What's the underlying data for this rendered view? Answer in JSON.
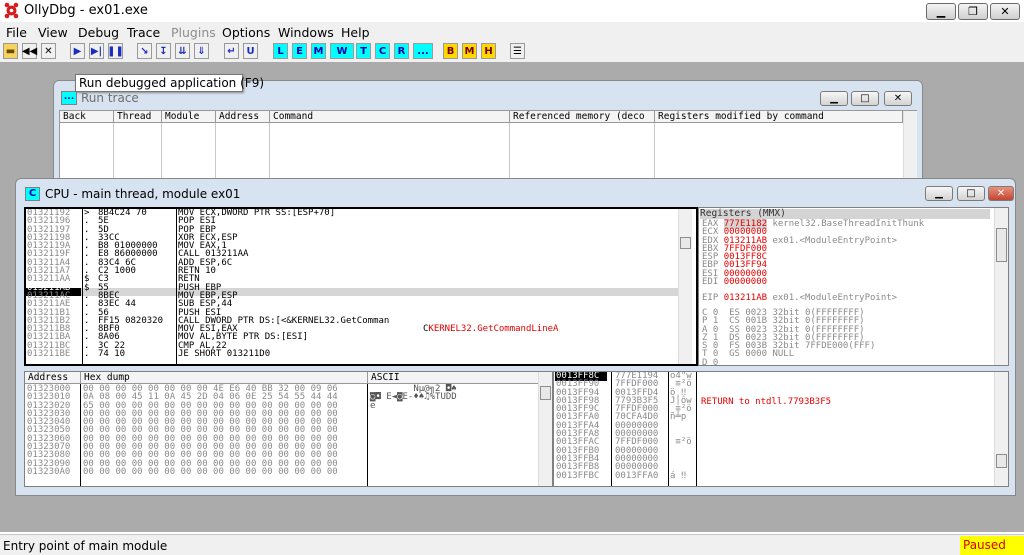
{
  "app": {
    "title": "OllyDbg - ex01.exe"
  },
  "menu": [
    "File",
    "View",
    "Debug",
    "Trace",
    "Plugins",
    "Options",
    "Windows",
    "Help"
  ],
  "toolbar_letters": [
    "L",
    "E",
    "M",
    "W",
    "T",
    "C",
    "R",
    "...",
    "B",
    "M",
    "H"
  ],
  "tooltip": "Run debugged application (F9)",
  "run_trace": {
    "title": "Run trace",
    "icon": "...",
    "columns": [
      "Back",
      "Thread",
      "Module",
      "Address",
      "Command",
      "Referenced memory (deco",
      "Registers modified by command"
    ]
  },
  "cpu": {
    "title": "CPU - main thread, module ex01",
    "icon": "C",
    "disasm": [
      {
        "addr": "01321192",
        "mark": ">",
        "hex": "8B4C24 70",
        "cmd": "MOV ECX,DWORD PTR SS:[ESP+70]"
      },
      {
        "addr": "01321196",
        "mark": ".",
        "hex": "5E",
        "cmd": "POP ESI"
      },
      {
        "addr": "01321197",
        "mark": ".",
        "hex": "5D",
        "cmd": "POP EBP"
      },
      {
        "addr": "01321198",
        "mark": ".",
        "hex": "33CC",
        "cmd": "XOR ECX,ESP"
      },
      {
        "addr": "0132119A",
        "mark": ".",
        "hex": "B8 01000000",
        "cmd": "MOV EAX,1"
      },
      {
        "addr": "0132119F",
        "mark": ".",
        "hex": "E8 86000000",
        "cmd": "CALL 013211AA"
      },
      {
        "addr": "013211A4",
        "mark": ".",
        "hex": "83C4 6C",
        "cmd": "ADD ESP,6C"
      },
      {
        "addr": "013211A7",
        "mark": ".",
        "hex": "C2 1000",
        "cmd": "RETN 10"
      },
      {
        "addr": "013211AA",
        "mark": "$",
        "hex": "C3",
        "cmd": "RETN"
      },
      {
        "addr": "013211AB",
        "mark": "$",
        "hex": "55",
        "cmd": "PUSH EBP"
      },
      {
        "addr": "013211AC",
        "mark": ".",
        "hex": "8BEC",
        "cmd": "MOV EBP,ESP"
      },
      {
        "addr": "013211AE",
        "mark": ".",
        "hex": "83EC 44",
        "cmd": "SUB ESP,44"
      },
      {
        "addr": "013211B1",
        "mark": ".",
        "hex": "56",
        "cmd": "PUSH ESI"
      },
      {
        "addr": "013211B2",
        "mark": ".",
        "hex": "FF15 0820320",
        "cmd": "CALL DWORD PTR DS:[<&KERNEL32.GetComman"
      },
      {
        "addr": "013211B8",
        "mark": ".",
        "hex": "8BF0",
        "cmd": "MOV ESI,EAX"
      },
      {
        "addr": "013211BA",
        "mark": ".",
        "hex": "8A06",
        "cmd": "MOV AL,BYTE PTR DS:[ESI]"
      },
      {
        "addr": "013211BC",
        "mark": ".",
        "hex": "3C 22",
        "cmd": "CMP AL,22"
      },
      {
        "addr": "013211BE",
        "mark": ".",
        "hex": "74 10",
        "cmd": "JE SHORT 013211D0"
      }
    ],
    "comment": "KERNEL32.GetCommandLineA",
    "registers": {
      "title": "Registers (MMX)",
      "general": [
        {
          "name": "EAX",
          "value": "777E1182",
          "info": "kernel32.BaseThreadInitThunk"
        },
        {
          "name": "ECX",
          "value": "00000000",
          "info": ""
        },
        {
          "name": "EDX",
          "value": "013211AB",
          "info": "ex01.<ModuleEntryPoint>"
        },
        {
          "name": "EBX",
          "value": "7FFDF000",
          "info": ""
        },
        {
          "name": "ESP",
          "value": "0013FF8C",
          "info": ""
        },
        {
          "name": "EBP",
          "value": "0013FF94",
          "info": ""
        },
        {
          "name": "ESI",
          "value": "00000000",
          "info": ""
        },
        {
          "name": "EDI",
          "value": "00000000",
          "info": ""
        }
      ],
      "eip": {
        "name": "EIP",
        "value": "013211AB",
        "info": "ex01.<ModuleEntryPoint>"
      },
      "flags": [
        "C 0  ES 0023 32bit 0(FFFFFFFF)",
        "P 1  CS 001B 32bit 0(FFFFFFFF)",
        "A 0  SS 0023 32bit 0(FFFFFFFF)",
        "Z 1  DS 0023 32bit 0(FFFFFFFF)",
        "S 0  FS 003B 32bit 7FFDE000(FFF)",
        "T 0  GS 0000 NULL",
        "D 0"
      ]
    },
    "dump": {
      "headers": [
        "Address",
        "Hex dump",
        "ASCII"
      ],
      "rows": [
        {
          "addr": "01323000",
          "hex": "00 00 00 00 00 00 00 00 4E E6 40 BB 32 00 09 06",
          "ascii": "        Nµ@╗2 ◘♠"
        },
        {
          "addr": "01323010",
          "hex": "0A 08 00 45 11 0A 45 2D 04 06 0E 25 54 55 44 44",
          "ascii": "◙◘ E◄◙E-♦♠♫%TUDD"
        },
        {
          "addr": "01323020",
          "hex": "65 00 00 00 00 00 00 00 00 00 00 00 00 00 00 00",
          "ascii": "e"
        },
        {
          "addr": "01323030",
          "hex": "00 00 00 00 00 00 00 00 00 00 00 00 00 00 00 00",
          "ascii": ""
        },
        {
          "addr": "01323040",
          "hex": "00 00 00 00 00 00 00 00 00 00 00 00 00 00 00 00",
          "ascii": ""
        },
        {
          "addr": "01323050",
          "hex": "00 00 00 00 00 00 00 00 00 00 00 00 00 00 00 00",
          "ascii": ""
        },
        {
          "addr": "01323060",
          "hex": "00 00 00 00 00 00 00 00 00 00 00 00 00 00 00 00",
          "ascii": ""
        },
        {
          "addr": "01323070",
          "hex": "00 00 00 00 00 00 00 00 00 00 00 00 00 00 00 00",
          "ascii": ""
        },
        {
          "addr": "01323080",
          "hex": "00 00 00 00 00 00 00 00 00 00 00 00 00 00 00 00",
          "ascii": ""
        },
        {
          "addr": "01323090",
          "hex": "00 00 00 00 00 00 00 00 00 00 00 00 00 00 00 00",
          "ascii": ""
        },
        {
          "addr": "013230A0",
          "hex": "00 00 00 00 00 00 00 00 00 00 00 00 00 00 00 00",
          "ascii": ""
        }
      ]
    },
    "stack": [
      {
        "addr": "0013FF8C",
        "value": "777E1194",
        "info": "ö4\"w"
      },
      {
        "addr": "0013FF90",
        "value": "7FFDF000",
        "info": " ≡²ö"
      },
      {
        "addr": "0013FF94",
        "value": "0013FFD4",
        "info": "ö ‼"
      },
      {
        "addr": "0013FF98",
        "value": "7793B3F5",
        "info": "J│ôw"
      },
      {
        "addr": "0013FF9C",
        "value": "7FFDF000",
        "info": " ≡²ö"
      },
      {
        "addr": "0013FFA0",
        "value": "70CFA4D0",
        "info": "ñ╧p"
      },
      {
        "addr": "0013FFA4",
        "value": "00000000",
        "info": ""
      },
      {
        "addr": "0013FFA8",
        "value": "00000000",
        "info": ""
      },
      {
        "addr": "0013FFAC",
        "value": "7FFDF000",
        "info": " ≡²ö"
      },
      {
        "addr": "0013FFB0",
        "value": "00000000",
        "info": ""
      },
      {
        "addr": "0013FFB4",
        "value": "00000000",
        "info": ""
      },
      {
        "addr": "0013FFB8",
        "value": "00000000",
        "info": ""
      },
      {
        "addr": "0013FFBC",
        "value": "0013FFA0",
        "info": "á ‼"
      }
    ],
    "stack_comment": "RETURN to ntdll.7793B3F5"
  },
  "status": {
    "text": "Entry point of main module",
    "state": "Paused"
  }
}
